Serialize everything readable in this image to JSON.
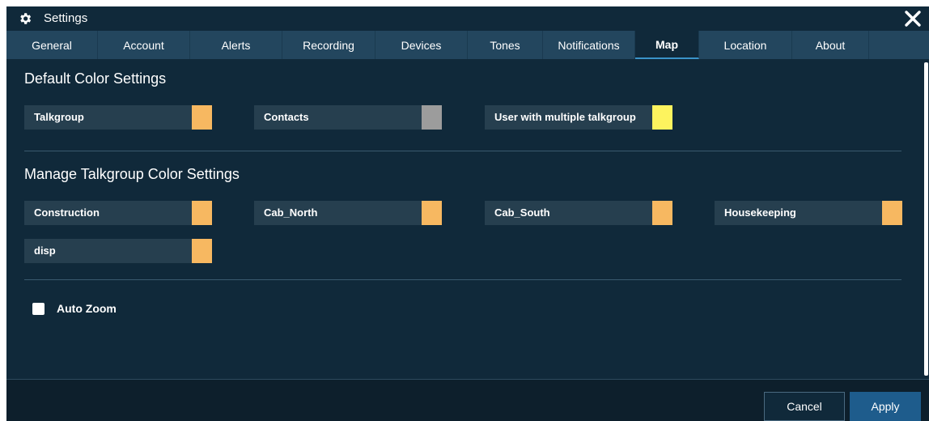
{
  "window": {
    "title": "Settings"
  },
  "tabs": [
    {
      "label": "General"
    },
    {
      "label": "Account"
    },
    {
      "label": "Alerts"
    },
    {
      "label": "Recording"
    },
    {
      "label": "Devices"
    },
    {
      "label": "Tones"
    },
    {
      "label": "Notifications"
    },
    {
      "label": "Map",
      "active": true
    },
    {
      "label": "Location"
    },
    {
      "label": "About"
    }
  ],
  "default_colors": {
    "title": "Default Color Settings",
    "items": [
      {
        "label": "Talkgroup",
        "color": "#f7b861"
      },
      {
        "label": "Contacts",
        "color": "#9c9c9c"
      },
      {
        "label": "User with multiple talkgroup",
        "color": "#fdf35e"
      }
    ]
  },
  "talkgroup_colors": {
    "title": "Manage Talkgroup Color Settings",
    "items": [
      {
        "label": "Construction",
        "color": "#f7b861"
      },
      {
        "label": "Cab_North",
        "color": "#f7b861"
      },
      {
        "label": "Cab_South",
        "color": "#f7b861"
      },
      {
        "label": "Housekeeping",
        "color": "#f7b861"
      },
      {
        "label": "disp",
        "color": "#f7b861"
      }
    ]
  },
  "auto_zoom": {
    "label": "Auto Zoom",
    "checked": false
  },
  "footer": {
    "cancel_label": "Cancel",
    "apply_label": "Apply"
  },
  "colors": {
    "background": "#10293a",
    "tabbar": "#23465e",
    "apply_button": "#1e5c8c"
  }
}
